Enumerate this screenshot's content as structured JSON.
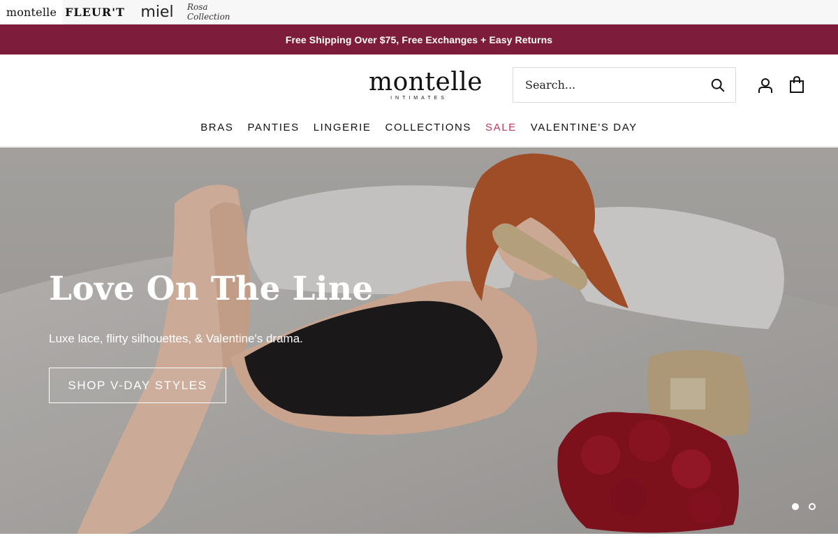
{
  "brand_switcher": {
    "brands": [
      "montelle",
      "FLEUR'T",
      "miel",
      "Rosa Collection"
    ]
  },
  "announcement": {
    "text": "Free Shipping Over $75, Free Exchanges + Easy Returns",
    "color": "#7e1d3b"
  },
  "header": {
    "logo": {
      "wordmark": "montelle",
      "tagline": "INTIMATES"
    },
    "search": {
      "placeholder": "Search...",
      "icon": "search-icon"
    },
    "account_icon": "user-icon",
    "cart_icon": "shopping-bag-icon"
  },
  "nav": {
    "items": [
      "BRAS",
      "PANTIES",
      "LINGERIE",
      "COLLECTIONS",
      "SALE",
      "VALENTINE'S DAY"
    ],
    "sale_color": "#c4385a"
  },
  "hero": {
    "title": "Love On The Line",
    "subtitle": "Luxe lace, flirty silhouettes, & Valentine's drama.",
    "cta_label": "SHOP V-DAY STYLES",
    "slide_count": 2,
    "active_slide": 1
  }
}
